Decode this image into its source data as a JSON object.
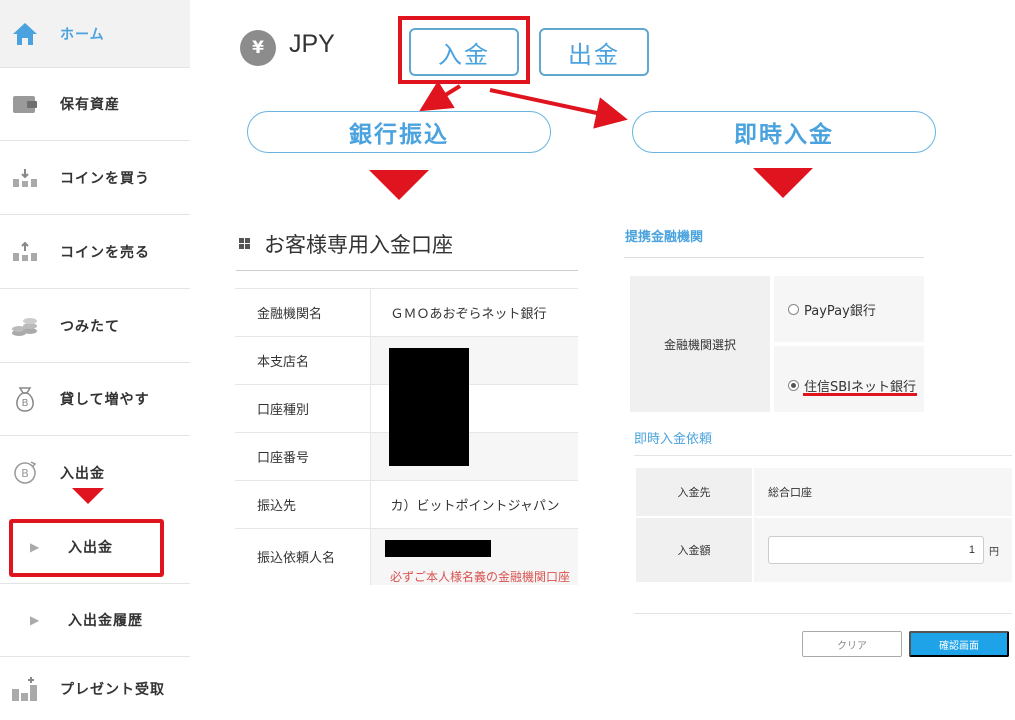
{
  "sidebar": {
    "items": [
      {
        "label": "ホーム",
        "icon": "home-icon"
      },
      {
        "label": "保有資産",
        "icon": "wallet-icon"
      },
      {
        "label": "コインを買う",
        "icon": "coin-buy-icon"
      },
      {
        "label": "コインを売る",
        "icon": "coin-sell-icon"
      },
      {
        "label": "つみたて",
        "icon": "coin-stack-icon"
      },
      {
        "label": "貸して増やす",
        "icon": "money-bag-icon"
      },
      {
        "label": "入出金",
        "icon": "bitcoin-transfer-icon"
      },
      {
        "label": "プレゼント受取",
        "icon": "gift-icon"
      }
    ],
    "sub_items": [
      {
        "label": "入出金"
      },
      {
        "label": "入出金履歴"
      }
    ]
  },
  "header": {
    "coin_symbol": "¥",
    "currency": "JPY",
    "deposit_label": "入金",
    "withdraw_label": "出金"
  },
  "methods": {
    "bank_transfer": "銀行振込",
    "instant_deposit": "即時入金"
  },
  "bank_account": {
    "title": "お客様専用入金口座",
    "rows": [
      {
        "label": "金融機関名",
        "value": "ＧＭＯあおぞらネット銀行"
      },
      {
        "label": "本支店名",
        "value": ""
      },
      {
        "label": "口座種別",
        "value": ""
      },
      {
        "label": "口座番号",
        "value": ""
      },
      {
        "label": "振込先",
        "value": "カ）ビットポイントジャパン"
      },
      {
        "label": "振込依頼人名",
        "value": ""
      }
    ],
    "note": "必ずご本人様名義の金融機関口座"
  },
  "instant": {
    "partner_title": "提携金融機関",
    "select_label": "金融機関選択",
    "options": [
      {
        "label": "PayPay銀行",
        "selected": false
      },
      {
        "label": "住信SBIネット銀行",
        "selected": true
      }
    ],
    "request_title": "即時入金依頼",
    "dest_label": "入金先",
    "dest_value": "総合口座",
    "amount_label": "入金額",
    "amount_value": "1",
    "amount_unit": "円",
    "clear_label": "クリア",
    "confirm_label": "確認画面"
  },
  "colors": {
    "accent": "#4aa3df",
    "highlight": "#e0141e",
    "confirm": "#1ea3e8"
  }
}
